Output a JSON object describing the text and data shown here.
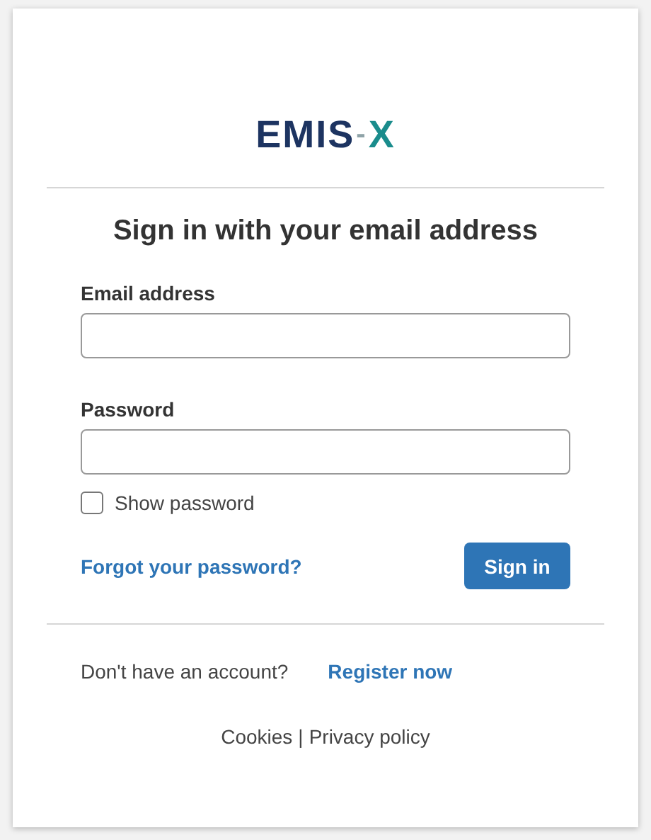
{
  "logo": {
    "main": "EMIS",
    "separator": "-",
    "accent": "X"
  },
  "heading": "Sign in with your email address",
  "fields": [
    {
      "label": "Email address"
    },
    {
      "label": "Password"
    }
  ],
  "show_password": {
    "label": "Show password",
    "checked": false
  },
  "forgot_link": "Forgot your password?",
  "sign_in_button": "Sign in",
  "register": {
    "prompt": "Don't have an account?",
    "link": "Register now"
  },
  "footer": {
    "links": [
      "Cookies",
      "Privacy policy"
    ],
    "separator": "|"
  }
}
